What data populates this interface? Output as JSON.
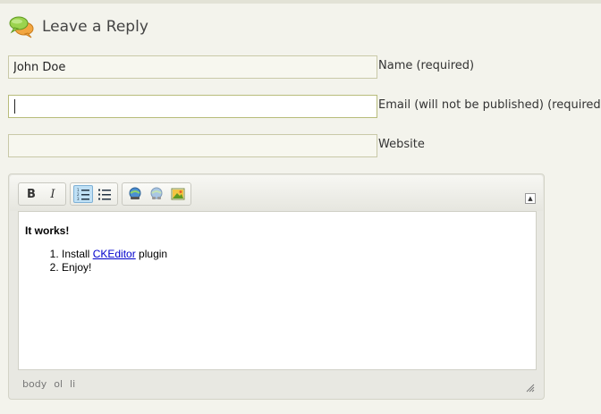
{
  "heading": {
    "title": "Leave a Reply",
    "icon": "speech-bubbles-icon"
  },
  "form": {
    "name": {
      "value": "John Doe",
      "label": "Name (required)"
    },
    "email": {
      "value": "",
      "label": "Email (will not be published) (required)"
    },
    "website": {
      "value": "",
      "label": "Website"
    }
  },
  "editor": {
    "toolbar": {
      "bold": "B",
      "italic": "I",
      "numbered_list_icon": "numbered-list-icon",
      "bulleted_list_icon": "bulleted-list-icon",
      "link_icon": "link-icon",
      "unlink_icon": "unlink-icon",
      "image_icon": "image-icon",
      "collapse_icon": "collapse-toolbar-icon"
    },
    "content": {
      "heading": "It works!",
      "items": [
        {
          "prefix": "Install ",
          "link": "CKEditor",
          "suffix": " plugin"
        },
        {
          "text": "Enjoy!"
        }
      ]
    },
    "status_path": [
      "body",
      "ol",
      "li"
    ]
  },
  "colors": {
    "background": "#f3f3ec",
    "field_border": "#c9c9a8",
    "active_button": "#bfe0f5",
    "link": "#0000cc"
  }
}
